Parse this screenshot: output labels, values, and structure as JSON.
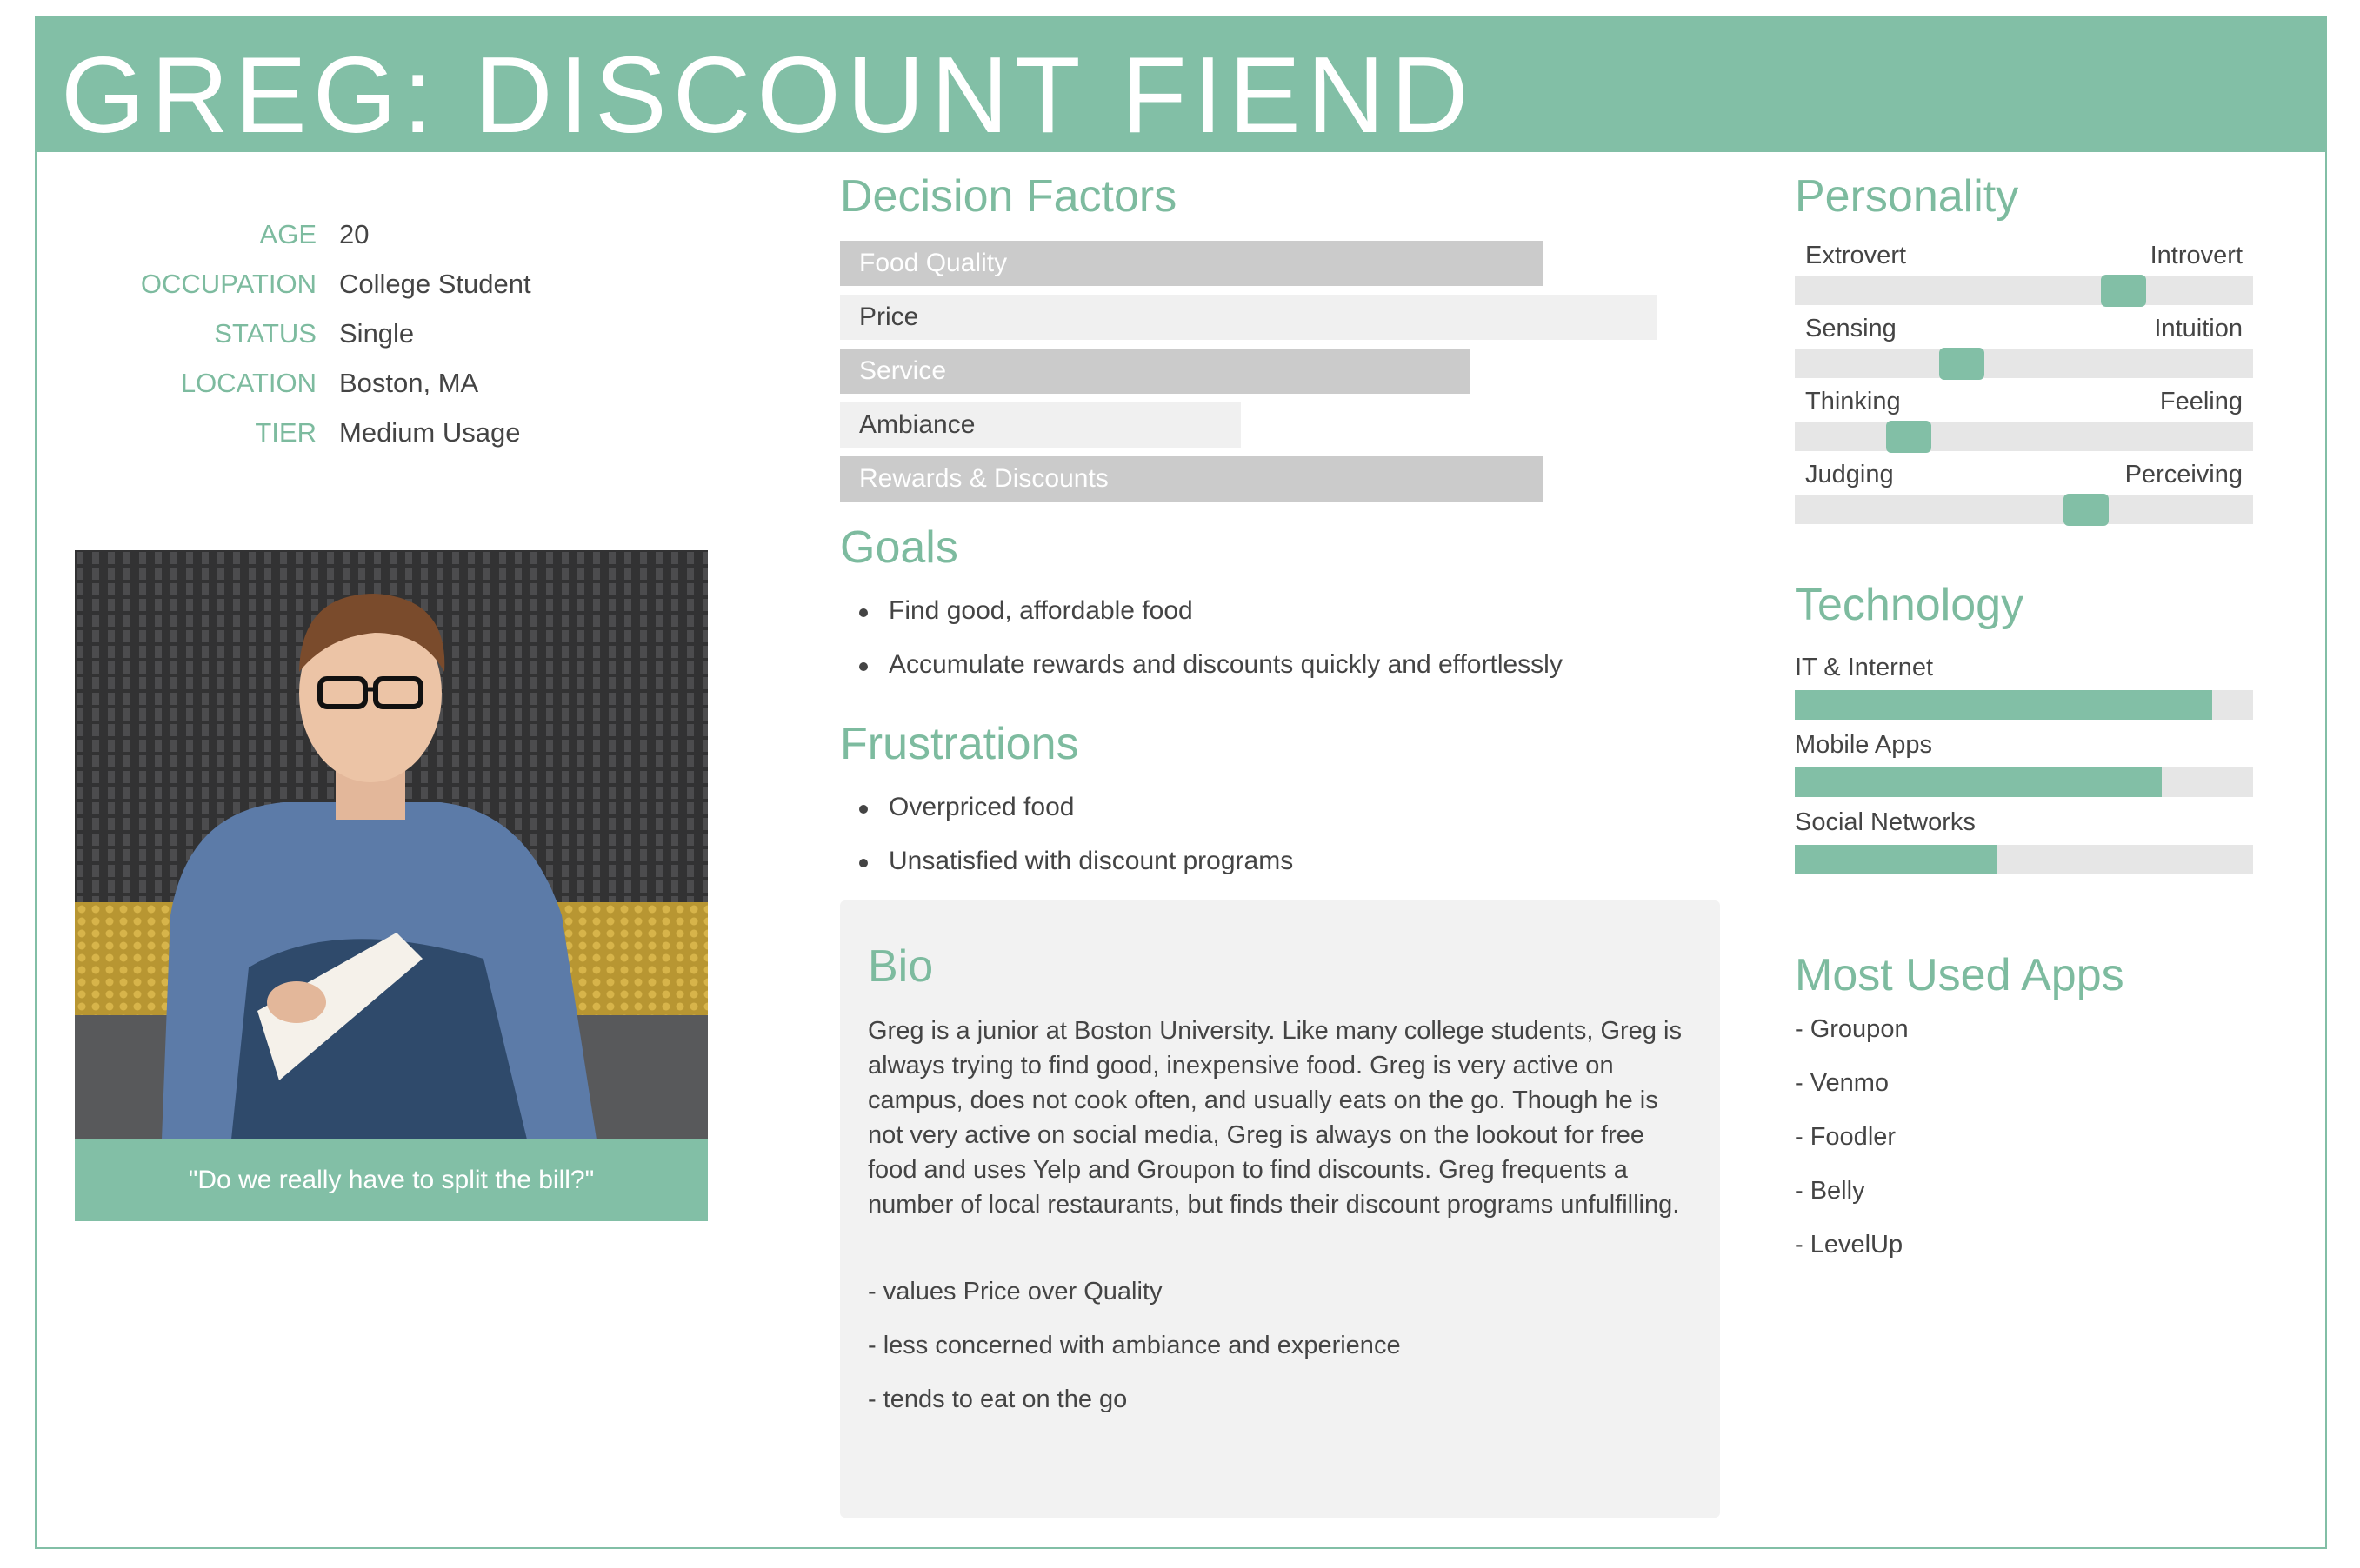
{
  "title": "GREG: DISCOUNT FIEND",
  "profile": [
    {
      "label": "AGE",
      "value": "20"
    },
    {
      "label": "OCCUPATION",
      "value": "College Student"
    },
    {
      "label": "STATUS",
      "value": "Single"
    },
    {
      "label": "LOCATION",
      "value": "Boston, MA"
    },
    {
      "label": "TIER",
      "value": "Medium Usage"
    }
  ],
  "photo": {
    "quote": "\"Do we really have to split the bill?\""
  },
  "decision_factors": {
    "heading": "Decision Factors",
    "items": [
      {
        "label": "Food Quality",
        "level": 0.86,
        "style": "dark"
      },
      {
        "label": "Price",
        "level": 1.0,
        "style": "light"
      },
      {
        "label": "Service",
        "level": 0.77,
        "style": "dark"
      },
      {
        "label": "Ambiance",
        "level": 0.49,
        "style": "light"
      },
      {
        "label": "Rewards & Discounts",
        "level": 0.86,
        "style": "dark"
      }
    ]
  },
  "goals": {
    "heading": "Goals",
    "items": [
      "Find good, affordable food",
      "Accumulate rewards and discounts quickly and effortlessly"
    ]
  },
  "frustrations": {
    "heading": "Frustrations",
    "items": [
      "Overpriced food",
      "Unsatisfied with discount programs"
    ]
  },
  "bio": {
    "heading": "Bio",
    "text": "Greg is a junior at Boston University. Like many college students, Greg is always trying to find good, inexpensive food. Greg is very active on campus, does not cook often, and usually eats on the go. Though he is not very active on social media, Greg is always on the lookout for free food and uses Yelp and Groupon to find discounts. Greg frequents a number of local restaurants, but finds their discount programs unfulfilling.",
    "notes": [
      "- values Price over Quality",
      "- less concerned with ambiance and experience",
      "- tends to eat on the go"
    ]
  },
  "personality": {
    "heading": "Personality",
    "traits": [
      {
        "left": "Extrovert",
        "right": "Introvert",
        "level": 0.74
      },
      {
        "left": "Sensing",
        "right": "Intuition",
        "level": 0.35
      },
      {
        "left": "Thinking",
        "right": "Feeling",
        "level": 0.22
      },
      {
        "left": "Judging",
        "right": "Perceiving",
        "level": 0.65
      }
    ]
  },
  "technology": {
    "heading": "Technology",
    "items": [
      {
        "label": "IT & Internet",
        "level": 0.91
      },
      {
        "label": "Mobile Apps",
        "level": 0.8
      },
      {
        "label": "Social Networks",
        "level": 0.44
      }
    ]
  },
  "apps": {
    "heading": "Most Used Apps",
    "items": [
      "- Groupon",
      "- Venmo",
      "- Foodler",
      "- Belly",
      "- LevelUp"
    ]
  },
  "colors": {
    "accent": "#82bfa6",
    "bar_dark": "#cbcbcb",
    "bar_light": "#f0f0f0",
    "track": "#e6e6e6",
    "bio_bg": "#f2f2f2"
  }
}
